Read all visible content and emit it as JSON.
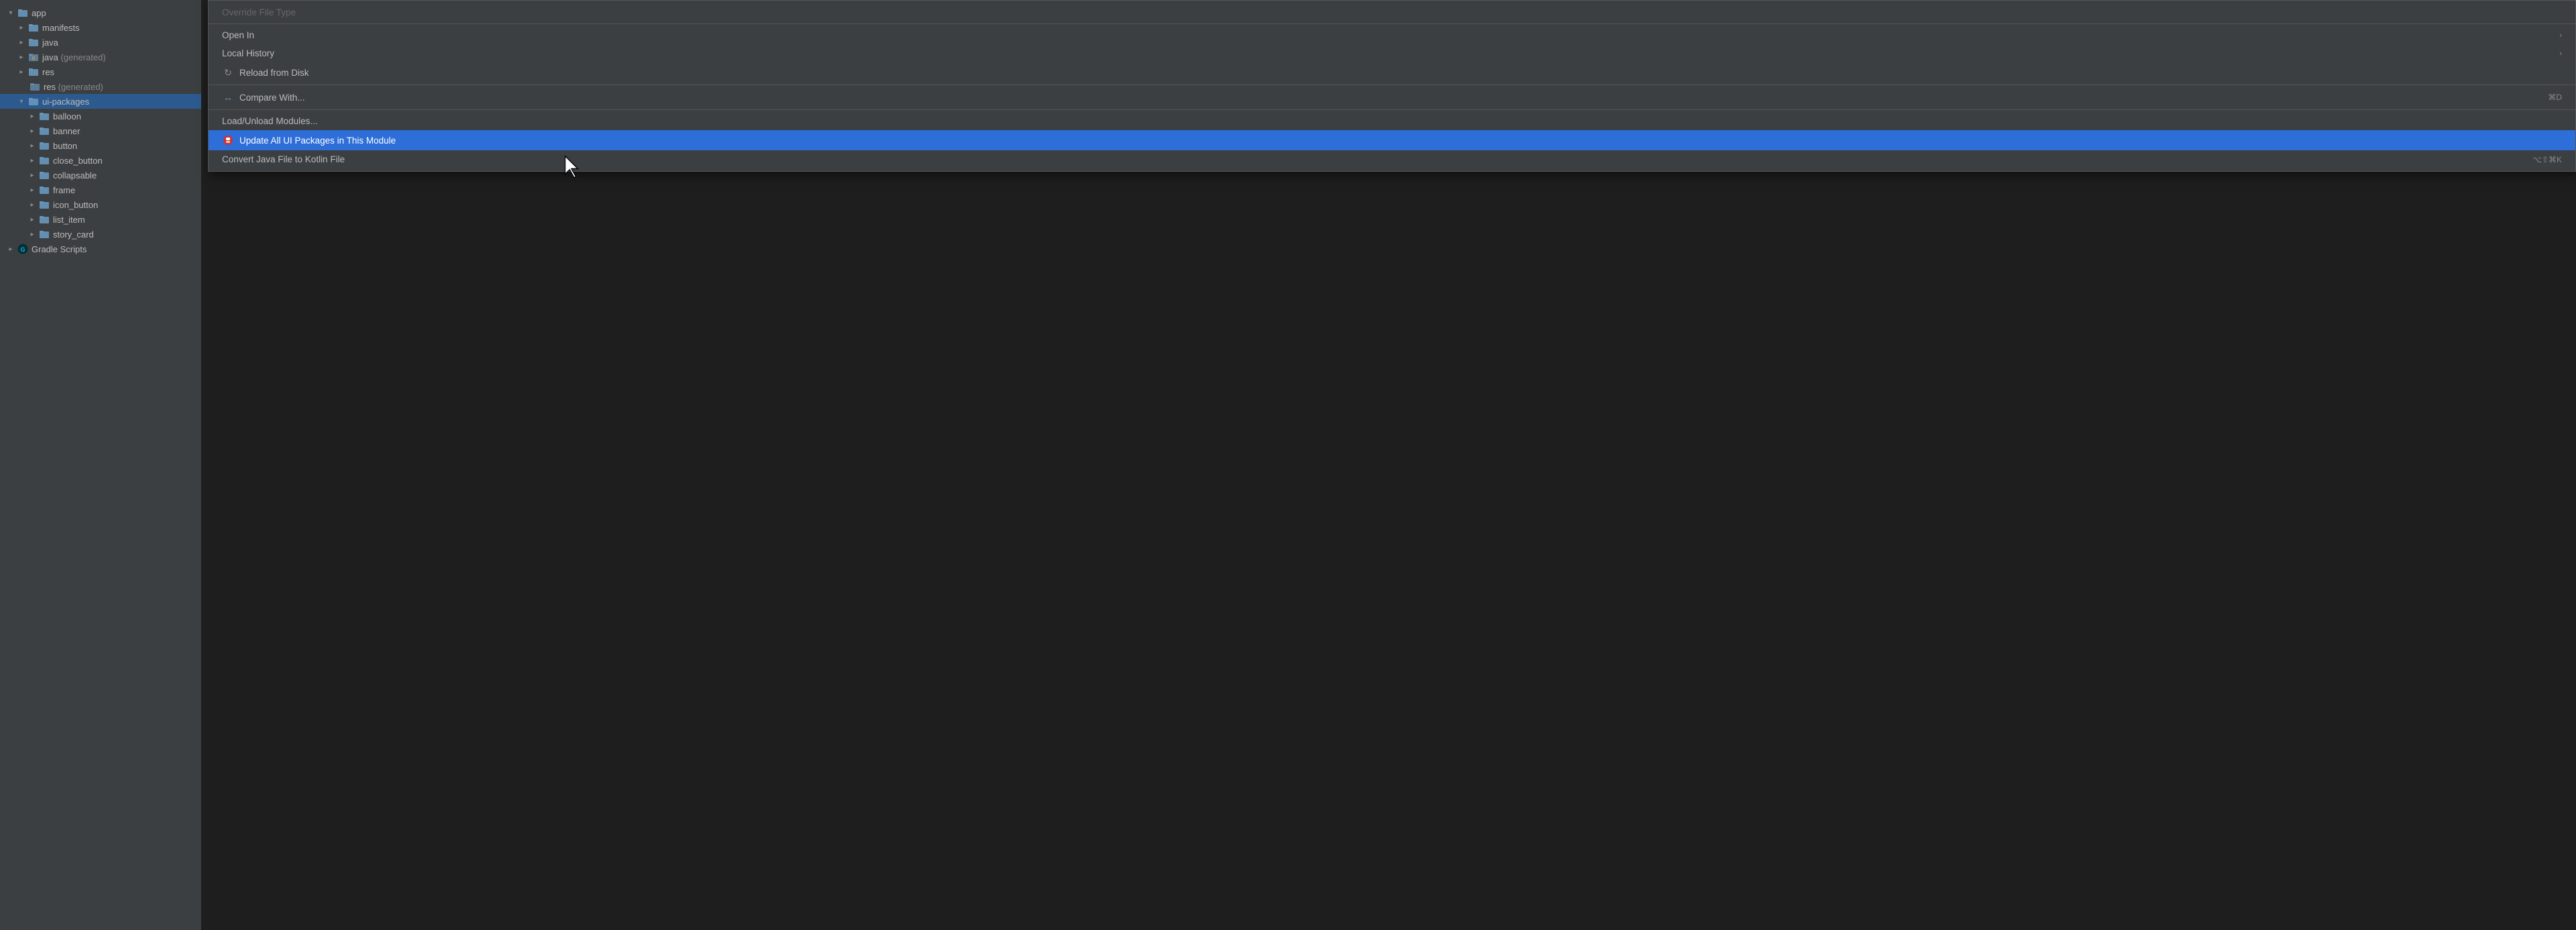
{
  "sidebar": {
    "items": [
      {
        "id": "app",
        "label": "app",
        "level": 0,
        "type": "folder-open",
        "expanded": true,
        "color": "#6897bb"
      },
      {
        "id": "manifests",
        "label": "manifests",
        "level": 1,
        "type": "folder",
        "expanded": false,
        "color": "#6897bb"
      },
      {
        "id": "java",
        "label": "java",
        "level": 1,
        "type": "folder",
        "expanded": false,
        "color": "#6897bb"
      },
      {
        "id": "java-generated",
        "label": "java",
        "labelSuffix": " (generated)",
        "level": 1,
        "type": "folder-special",
        "expanded": false,
        "color": "#6897bb"
      },
      {
        "id": "res",
        "label": "res",
        "level": 1,
        "type": "folder",
        "expanded": false,
        "color": "#6897bb"
      },
      {
        "id": "res-generated",
        "label": "res",
        "labelSuffix": " (generated)",
        "level": 1,
        "type": "folder-special",
        "expanded": false,
        "noChevron": true,
        "color": "#6897bb"
      },
      {
        "id": "ui-packages",
        "label": "ui-packages",
        "level": 1,
        "type": "folder-open",
        "expanded": true,
        "selected": true,
        "color": "#6897bb"
      },
      {
        "id": "balloon",
        "label": "balloon",
        "level": 2,
        "type": "folder",
        "expanded": false,
        "color": "#6897bb"
      },
      {
        "id": "banner",
        "label": "banner",
        "level": 2,
        "type": "folder",
        "expanded": false,
        "color": "#6897bb"
      },
      {
        "id": "button",
        "label": "button",
        "level": 2,
        "type": "folder",
        "expanded": false,
        "color": "#6897bb"
      },
      {
        "id": "close_button",
        "label": "close_button",
        "level": 2,
        "type": "folder",
        "expanded": false,
        "color": "#6897bb"
      },
      {
        "id": "collapsable",
        "label": "collapsable",
        "level": 2,
        "type": "folder",
        "expanded": false,
        "color": "#6897bb"
      },
      {
        "id": "frame",
        "label": "frame",
        "level": 2,
        "type": "folder",
        "expanded": false,
        "color": "#6897bb"
      },
      {
        "id": "icon_button",
        "label": "icon_button",
        "level": 2,
        "type": "folder",
        "expanded": false,
        "color": "#6897bb"
      },
      {
        "id": "list_item",
        "label": "list_item",
        "level": 2,
        "type": "folder",
        "expanded": false,
        "color": "#6897bb"
      },
      {
        "id": "story_card",
        "label": "story_card",
        "level": 2,
        "type": "folder",
        "expanded": false,
        "color": "#6897bb"
      },
      {
        "id": "gradle-scripts",
        "label": "Gradle Scripts",
        "level": 0,
        "type": "gradle",
        "expanded": false
      }
    ]
  },
  "context_menu": {
    "items": [
      {
        "id": "override-file-type",
        "label": "Override File Type",
        "disabled": true
      },
      {
        "id": "separator-1",
        "type": "separator"
      },
      {
        "id": "open-in",
        "label": "Open In",
        "hasSubmenu": true
      },
      {
        "id": "local-history",
        "label": "Local History",
        "hasSubmenu": true
      },
      {
        "id": "reload-from-disk",
        "label": "Reload from Disk",
        "hasIcon": true,
        "iconType": "reload"
      },
      {
        "id": "separator-2",
        "type": "separator"
      },
      {
        "id": "compare-with",
        "label": "Compare With...",
        "shortcut": "⌘D"
      },
      {
        "id": "separator-3",
        "type": "separator"
      },
      {
        "id": "load-unload-modules",
        "label": "Load/Unload Modules..."
      },
      {
        "id": "update-all-ui-packages",
        "label": "Update All UI Packages in This Module",
        "highlighted": true,
        "hasIcon": true,
        "iconType": "plugin-red"
      },
      {
        "id": "convert-java-kotlin",
        "label": "Convert Java File to Kotlin File",
        "shortcut": "⌥⇧⌘K"
      }
    ]
  }
}
